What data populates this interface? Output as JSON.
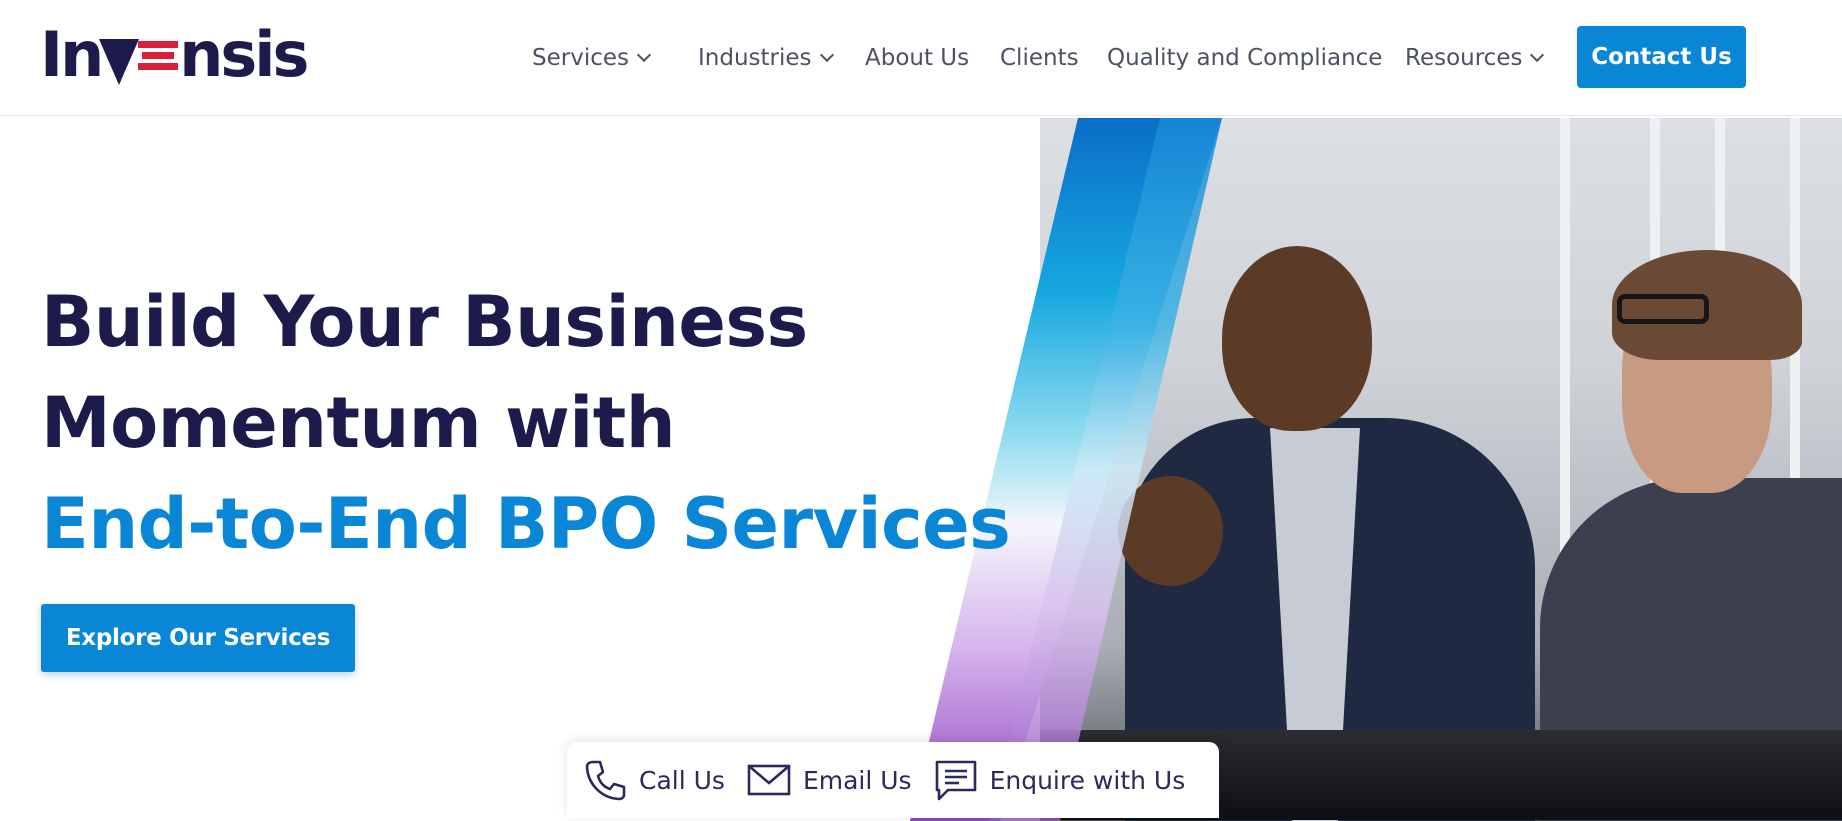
{
  "header": {
    "logo_text": "INVENSIS",
    "nav": [
      {
        "label": "Services",
        "has_dropdown": true
      },
      {
        "label": "Industries",
        "has_dropdown": true
      },
      {
        "label": "About Us",
        "has_dropdown": false
      },
      {
        "label": "Clients",
        "has_dropdown": false
      },
      {
        "label": "Quality and Compliance",
        "has_dropdown": false
      },
      {
        "label": "Resources",
        "has_dropdown": true
      }
    ],
    "contact_label": "Contact Us"
  },
  "hero": {
    "title_line1": "Build Your Business",
    "title_line2": "Momentum with",
    "title_line3": "End-to-End BPO Services",
    "cta_label": "Explore Our Services"
  },
  "contact_bar": {
    "call_label": "Call Us",
    "email_label": "Email Us",
    "enquire_label": "Enquire with Us"
  },
  "colors": {
    "brand_navy": "#1c1b4b",
    "brand_blue": "#0a86d6",
    "logo_red": "#d8203a"
  }
}
